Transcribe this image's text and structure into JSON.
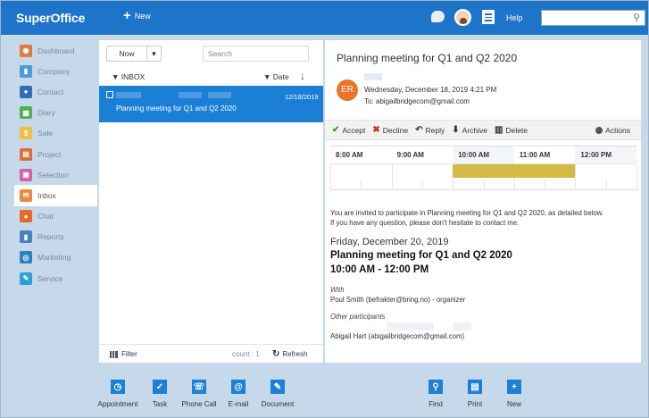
{
  "app": {
    "logo": "SuperOffice",
    "new_label": "New",
    "help_label": "Help"
  },
  "sidebar": {
    "items": [
      {
        "label": "Dashboard",
        "color": "#e07b39",
        "glyph": "◉"
      },
      {
        "label": "Company",
        "color": "#4a9bd8",
        "glyph": "▮"
      },
      {
        "label": "Contact",
        "color": "#2e6fb8",
        "glyph": "●"
      },
      {
        "label": "Diary",
        "color": "#4caf50",
        "glyph": "▦"
      },
      {
        "label": "Sale",
        "color": "#f0c040",
        "glyph": "$"
      },
      {
        "label": "Project",
        "color": "#e36a3a",
        "glyph": "▤"
      },
      {
        "label": "Selection",
        "color": "#d35fa8",
        "glyph": "▣"
      },
      {
        "label": "Inbox",
        "color": "#e98a3c",
        "glyph": "✉"
      },
      {
        "label": "Chat",
        "color": "#e56a2a",
        "glyph": "●"
      },
      {
        "label": "Reports",
        "color": "#4a7fc1",
        "glyph": "▮"
      },
      {
        "label": "Marketing",
        "color": "#2f7fc8",
        "glyph": "◎"
      },
      {
        "label": "Service",
        "color": "#2da0d8",
        "glyph": "✎"
      }
    ],
    "active_index": 7
  },
  "list": {
    "now_label": "Now",
    "search_placeholder": "Search",
    "folder_label": "INBOX",
    "sort_label": "Date",
    "items": [
      {
        "date": "12/18/2019",
        "subject": "Planning meeting for Q1 and Q2 2020"
      }
    ],
    "filter_label": "Filter",
    "count_label": "count : 1",
    "refresh_label": "Refresh"
  },
  "detail": {
    "subject": "Planning meeting for Q1 and Q2 2020",
    "sender_initials": "ER",
    "sender_color": "#e8742a",
    "sent": "Wednesday, December 18, 2019 4:21 PM",
    "to": "To: abigailbridgecom@gmail.com",
    "actions": {
      "accept": "Accept",
      "decline": "Decline",
      "reply": "Reply",
      "archive": "Archive",
      "delete": "Delete",
      "more": "Actions"
    },
    "timeline": {
      "hours": [
        "8:00 AM",
        "9:00 AM",
        "10:00 AM",
        "11:00 AM",
        "12:00 PM"
      ],
      "busy_start_hour": 10,
      "busy_end_hour": 12,
      "busy_color": "#d4b944"
    },
    "invite_line1": "You are invited to participate in Planning meeting for Q1 and Q2 2020, as detailed below.",
    "invite_line2": "If you have any question, please don't hesitate to contact me.",
    "event_date": "Friday, December 20, 2019",
    "event_title": "Planning meeting for Q1 and Q2 2020",
    "event_time": "10:00 AM - 12:00 PM",
    "with_label": "With",
    "organizer": "Poul Smith (befrakter@bring.no) - organizer",
    "others_label": "Other participants",
    "participant": "Abigail Hart (abigailbridgecom@gmail.com)"
  },
  "bottom": {
    "left": [
      {
        "label": "Appointment",
        "glyph": "◷"
      },
      {
        "label": "Task",
        "glyph": "✓"
      },
      {
        "label": "Phone Call",
        "glyph": "☏"
      },
      {
        "label": "E-mail",
        "glyph": "@"
      },
      {
        "label": "Document",
        "glyph": "✎"
      }
    ],
    "right": [
      {
        "label": "Find",
        "glyph": "⚲"
      },
      {
        "label": "Print",
        "glyph": "▤"
      },
      {
        "label": "New",
        "glyph": "+"
      }
    ]
  }
}
